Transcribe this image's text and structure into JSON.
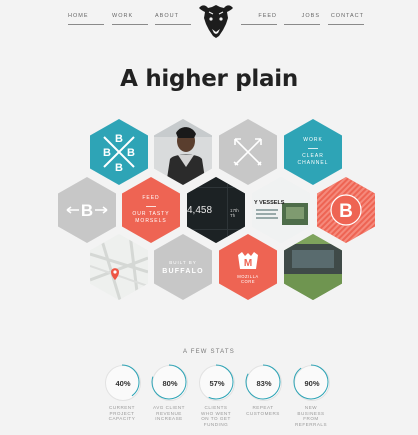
{
  "nav": {
    "home": "HOME",
    "work": "WORK",
    "about": "ABOUT",
    "feed": "FEED",
    "jobs": "JOBS",
    "contact": "CONTACT"
  },
  "logo": {
    "icon": "bison-head-icon"
  },
  "headline": "A higher plain",
  "tiles": {
    "work_label": "WORK",
    "work_title": "CLEAR\nCHANNEL",
    "feed_label": "FEED",
    "feed_title": "OUR TASTY\nMORSELS",
    "dark_number": "4,458",
    "mini_tag": "17th Th",
    "news_headline": "Y VESSELS",
    "buffalo_text": "BUFFALO",
    "buffalo_built": "BUILT BY",
    "mozilla_text": "MOZILLA",
    "mozilla_sub": "CORE"
  },
  "stats": {
    "title": "A FEW STATS",
    "items": [
      {
        "value": "40%",
        "label": "CURRENT\nPROJECT\nCAPACITY",
        "fraction": 0.4
      },
      {
        "value": "80%",
        "label": "AVG CLIENT\nREVENUE\nINCREASE",
        "fraction": 0.8
      },
      {
        "value": "57%",
        "label": "CLIENTS\nWHO WENT\nON TO GET\nFUNDING",
        "fraction": 0.57
      },
      {
        "value": "83%",
        "label": "REPEAT\nCUSTOMERS",
        "fraction": 0.83
      },
      {
        "value": "90%",
        "label": "NEW\nBUSINESS\nFROM\nREFERRALS",
        "fraction": 0.9
      }
    ]
  },
  "colors": {
    "teal": "#2ea4b6",
    "coral": "#ee6453",
    "grey": "#c7c7c7",
    "dark": "#1f2426",
    "arc": "#2aa3b5"
  }
}
